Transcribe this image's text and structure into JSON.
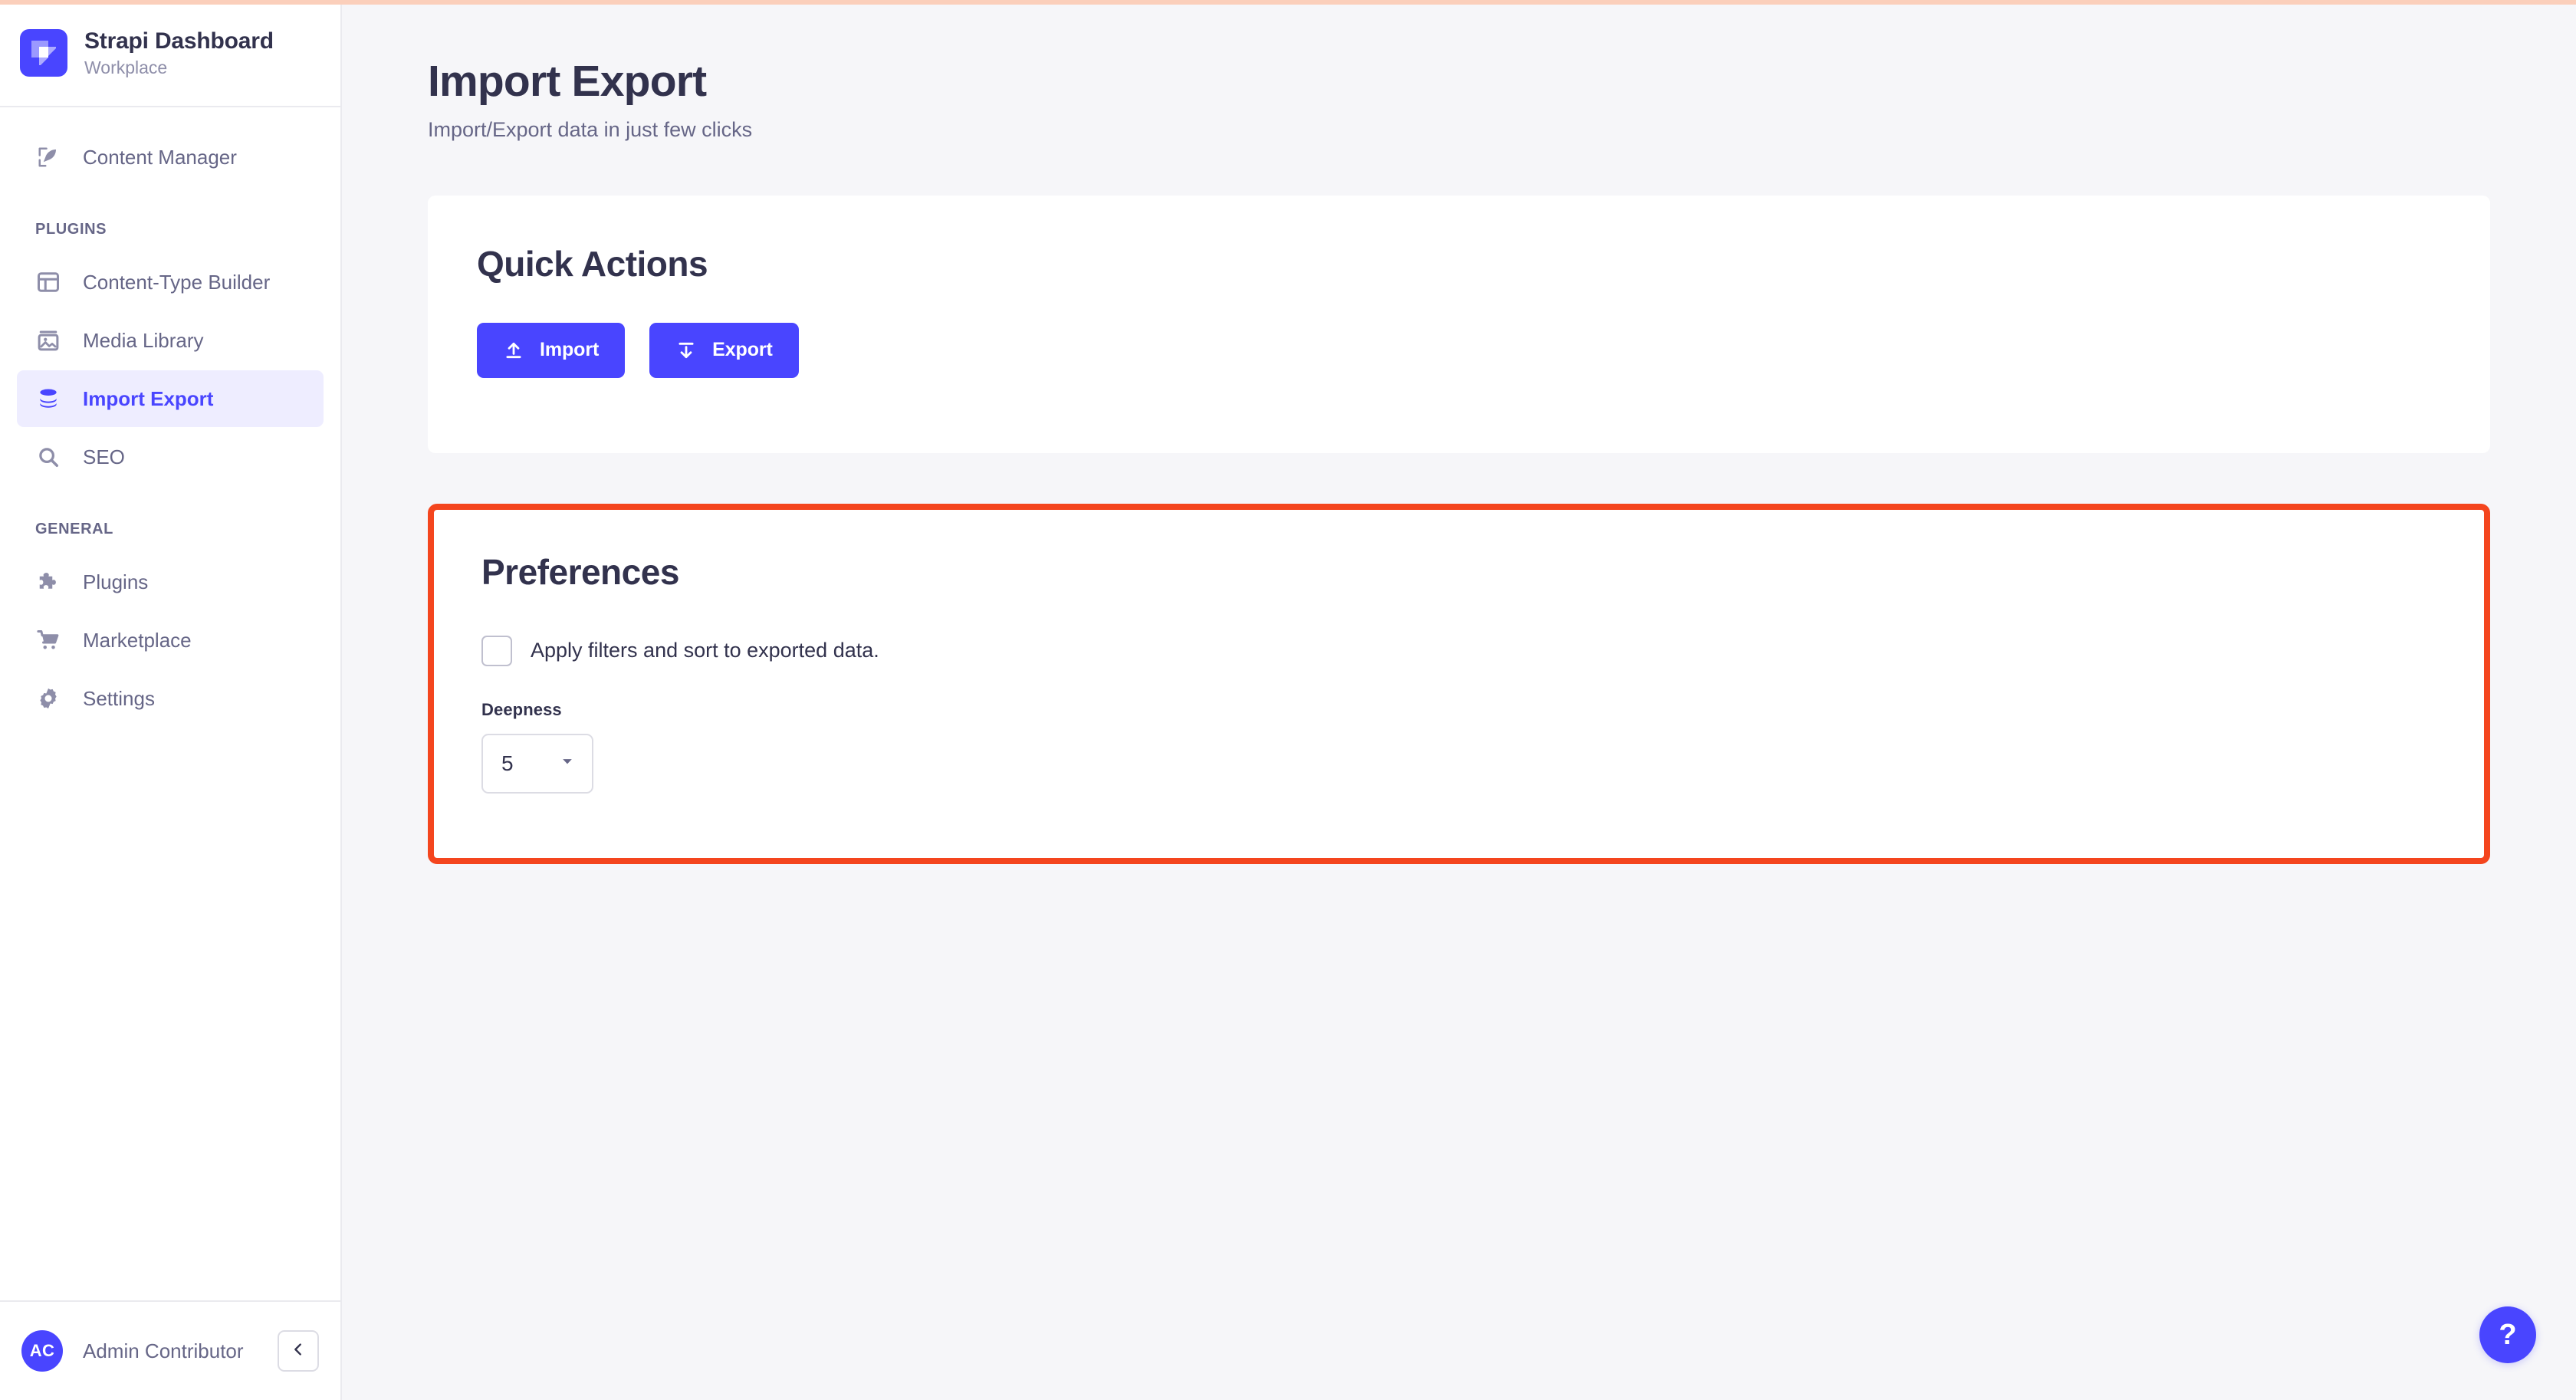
{
  "brand": {
    "title": "Strapi Dashboard",
    "subtitle": "Workplace",
    "logo_icon": "strapi-logo-icon",
    "logo_color": "#4945ff"
  },
  "sidebar": {
    "top_items": [
      {
        "label": "Content Manager",
        "icon": "feather-pen-icon",
        "active": false
      }
    ],
    "sections": [
      {
        "heading": "PLUGINS",
        "items": [
          {
            "label": "Content-Type Builder",
            "icon": "layout-grid-icon",
            "active": false
          },
          {
            "label": "Media Library",
            "icon": "image-icon",
            "active": false
          },
          {
            "label": "Import Export",
            "icon": "database-stack-icon",
            "active": true
          },
          {
            "label": "SEO",
            "icon": "search-icon",
            "active": false
          }
        ]
      },
      {
        "heading": "GENERAL",
        "items": [
          {
            "label": "Plugins",
            "icon": "puzzle-piece-icon",
            "active": false
          },
          {
            "label": "Marketplace",
            "icon": "shopping-cart-icon",
            "active": false
          },
          {
            "label": "Settings",
            "icon": "gear-icon",
            "active": false
          }
        ]
      }
    ],
    "user": {
      "initials": "AC",
      "name": "Admin Contributor",
      "collapse_icon": "chevron-left-icon"
    },
    "active_item_color": "#4945ff",
    "active_item_background": "#eeedff",
    "item_color": "#666687"
  },
  "page": {
    "title": "Import Export",
    "subtitle": "Import/Export data in just few clicks"
  },
  "quick_actions": {
    "title": "Quick Actions",
    "buttons": [
      {
        "label": "Import",
        "icon": "upload-arrow-icon"
      },
      {
        "label": "Export",
        "icon": "download-arrow-icon"
      }
    ],
    "button_color": "#4945ff"
  },
  "preferences": {
    "title": "Preferences",
    "highlight_border_color": "#f4451e",
    "checkbox": {
      "label": "Apply filters and sort to exported data.",
      "checked": false
    },
    "deepness": {
      "label": "Deepness",
      "value": "5",
      "chevron_icon": "chevron-down-icon"
    }
  },
  "help": {
    "label": "?",
    "icon": "question-mark-icon",
    "color": "#4945ff"
  },
  "top_strip_color": "#fbcfbb"
}
